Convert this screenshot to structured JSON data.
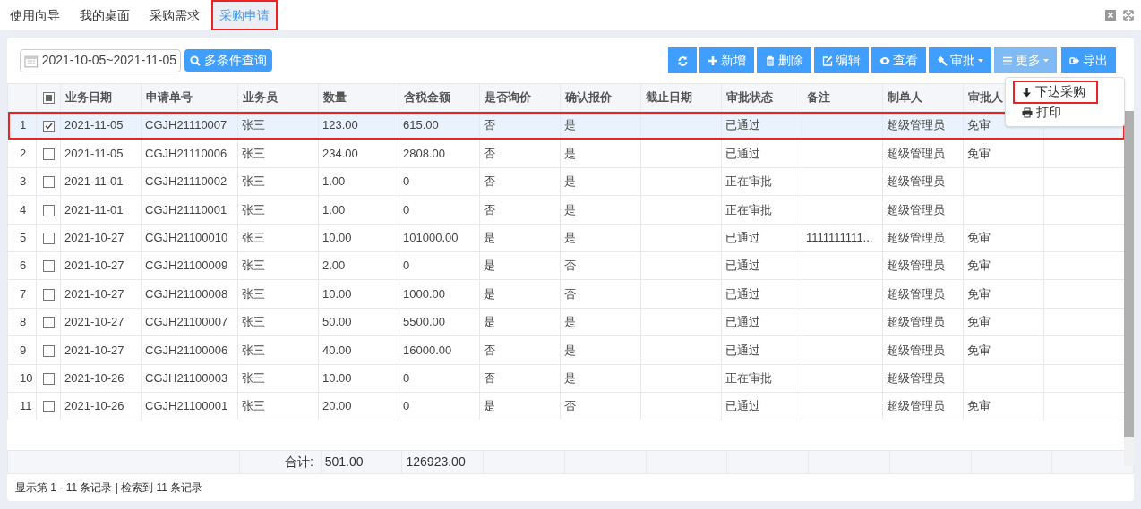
{
  "tabs": [
    {
      "label": "使用向导",
      "selected": false,
      "highlighted": false
    },
    {
      "label": "我的桌面",
      "selected": false,
      "highlighted": false
    },
    {
      "label": "采购需求",
      "selected": false,
      "highlighted": false
    },
    {
      "label": "采购申请",
      "selected": true,
      "highlighted": true
    }
  ],
  "date_range": {
    "value": "2021-10-05~2021-11-05"
  },
  "search_button": "多条件查询",
  "toolbar": [
    {
      "kind": "refresh",
      "active": false
    },
    {
      "kind": "add",
      "label": "新增",
      "active": false
    },
    {
      "kind": "delete",
      "label": "删除",
      "active": false
    },
    {
      "kind": "edit",
      "label": "编辑",
      "active": false
    },
    {
      "kind": "view",
      "label": "查看",
      "active": false
    },
    {
      "kind": "approve",
      "label": "审批",
      "active": false
    },
    {
      "kind": "more",
      "label": "更多",
      "active": true
    },
    {
      "kind": "export",
      "label": "导出",
      "active": false
    }
  ],
  "more_menu": [
    {
      "kind": "down",
      "label": "下达采购",
      "highlighted": true
    },
    {
      "kind": "print",
      "label": "打印",
      "highlighted": false
    }
  ],
  "table": {
    "select_all_partial": true,
    "columns": [
      "业务日期",
      "申请单号",
      "业务员",
      "数量",
      "含税金额",
      "是否询价",
      "确认报价",
      "截止日期",
      "审批状态",
      "备注",
      "制单人",
      "审批人"
    ],
    "rows": [
      {
        "index": "1",
        "selected": true,
        "highlighted": true,
        "cells": [
          "2021-11-05",
          "CGJH21110007",
          "张三",
          "123.00",
          "615.00",
          "否",
          "是",
          "",
          "已通过",
          "",
          "超级管理员",
          "免审"
        ]
      },
      {
        "index": "2",
        "selected": false,
        "highlighted": false,
        "cells": [
          "2021-11-05",
          "CGJH21110006",
          "张三",
          "234.00",
          "2808.00",
          "否",
          "是",
          "",
          "已通过",
          "",
          "超级管理员",
          "免审"
        ]
      },
      {
        "index": "3",
        "selected": false,
        "highlighted": false,
        "cells": [
          "2021-11-01",
          "CGJH21110002",
          "张三",
          "1.00",
          "0",
          "否",
          "是",
          "",
          "正在审批",
          "",
          "超级管理员",
          ""
        ]
      },
      {
        "index": "4",
        "selected": false,
        "highlighted": false,
        "cells": [
          "2021-11-01",
          "CGJH21110001",
          "张三",
          "1.00",
          "0",
          "否",
          "是",
          "",
          "正在审批",
          "",
          "超级管理员",
          ""
        ]
      },
      {
        "index": "5",
        "selected": false,
        "highlighted": false,
        "cells": [
          "2021-10-27",
          "CGJH21100010",
          "张三",
          "10.00",
          "101000.00",
          "是",
          "是",
          "",
          "已通过",
          "1111111111...",
          "超级管理员",
          "免审"
        ]
      },
      {
        "index": "6",
        "selected": false,
        "highlighted": false,
        "cells": [
          "2021-10-27",
          "CGJH21100009",
          "张三",
          "2.00",
          "0",
          "是",
          "否",
          "",
          "已通过",
          "",
          "超级管理员",
          "免审"
        ]
      },
      {
        "index": "7",
        "selected": false,
        "highlighted": false,
        "cells": [
          "2021-10-27",
          "CGJH21100008",
          "张三",
          "10.00",
          "1000.00",
          "是",
          "否",
          "",
          "已通过",
          "",
          "超级管理员",
          "免审"
        ]
      },
      {
        "index": "8",
        "selected": false,
        "highlighted": false,
        "cells": [
          "2021-10-27",
          "CGJH21100007",
          "张三",
          "50.00",
          "5500.00",
          "是",
          "是",
          "",
          "已通过",
          "",
          "超级管理员",
          "免审"
        ]
      },
      {
        "index": "9",
        "selected": false,
        "highlighted": false,
        "cells": [
          "2021-10-27",
          "CGJH21100006",
          "张三",
          "40.00",
          "16000.00",
          "否",
          "是",
          "",
          "已通过",
          "",
          "超级管理员",
          "免审"
        ]
      },
      {
        "index": "10",
        "selected": false,
        "highlighted": false,
        "cells": [
          "2021-10-26",
          "CGJH21100003",
          "张三",
          "10.00",
          "0",
          "否",
          "是",
          "",
          "正在审批",
          "",
          "超级管理员",
          ""
        ]
      },
      {
        "index": "11",
        "selected": false,
        "highlighted": false,
        "cells": [
          "2021-10-26",
          "CGJH21100001",
          "张三",
          "20.00",
          "0",
          "是",
          "否",
          "",
          "已通过",
          "",
          "超级管理员",
          "免审"
        ]
      }
    ],
    "totals": {
      "label": "合计:",
      "quantity": "501.00",
      "amount": "126923.00"
    }
  },
  "status": "显示第 1 - 11 条记录 | 检索到 11 条记录"
}
